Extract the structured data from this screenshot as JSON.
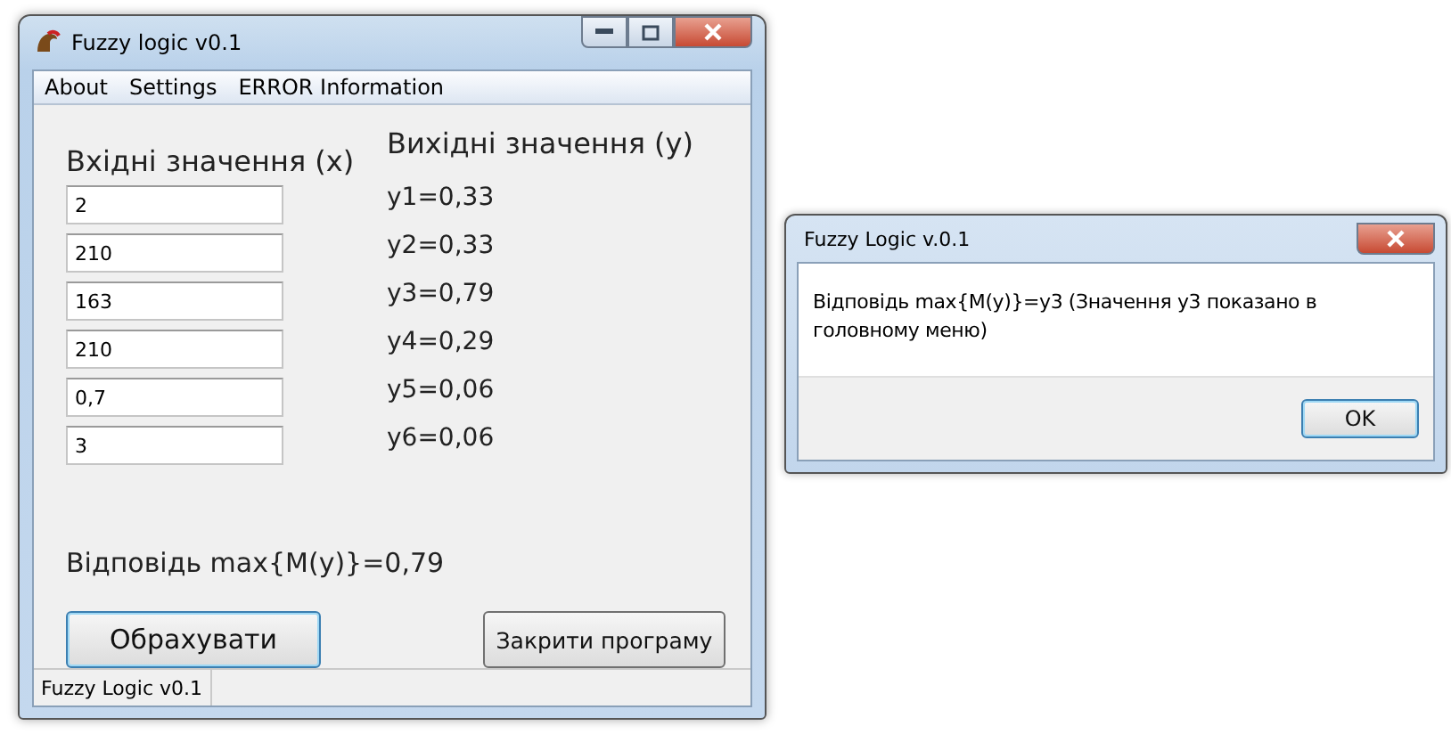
{
  "main_window": {
    "title": "Fuzzy logic v0.1",
    "menu": [
      "About",
      "Settings",
      "ERROR Information"
    ],
    "inputs_heading": "Вхідні значення (x)",
    "outputs_heading": "Вихідні значення (y)",
    "inputs": [
      "2",
      "210",
      "163",
      "210",
      "0,7",
      "3"
    ],
    "outputs": [
      "y1=0,33",
      "y2=0,33",
      "y3=0,79",
      "y4=0,29",
      "y5=0,06",
      "y6=0,06"
    ],
    "answer": "Відповідь max{M(y)}=0,79",
    "buttons": [
      {
        "label": "Обрахувати",
        "default": true
      },
      {
        "label": "Закрити програму",
        "default": false
      }
    ],
    "status_bar": "Fuzzy Logic v0.1"
  },
  "dialog": {
    "title": "Fuzzy Logic v.0.1",
    "message": "Відповідь max{M(y)}=y3 (Значення y3 показано в головному меню)",
    "buttons": [
      {
        "label": "OK",
        "default": true
      }
    ]
  }
}
